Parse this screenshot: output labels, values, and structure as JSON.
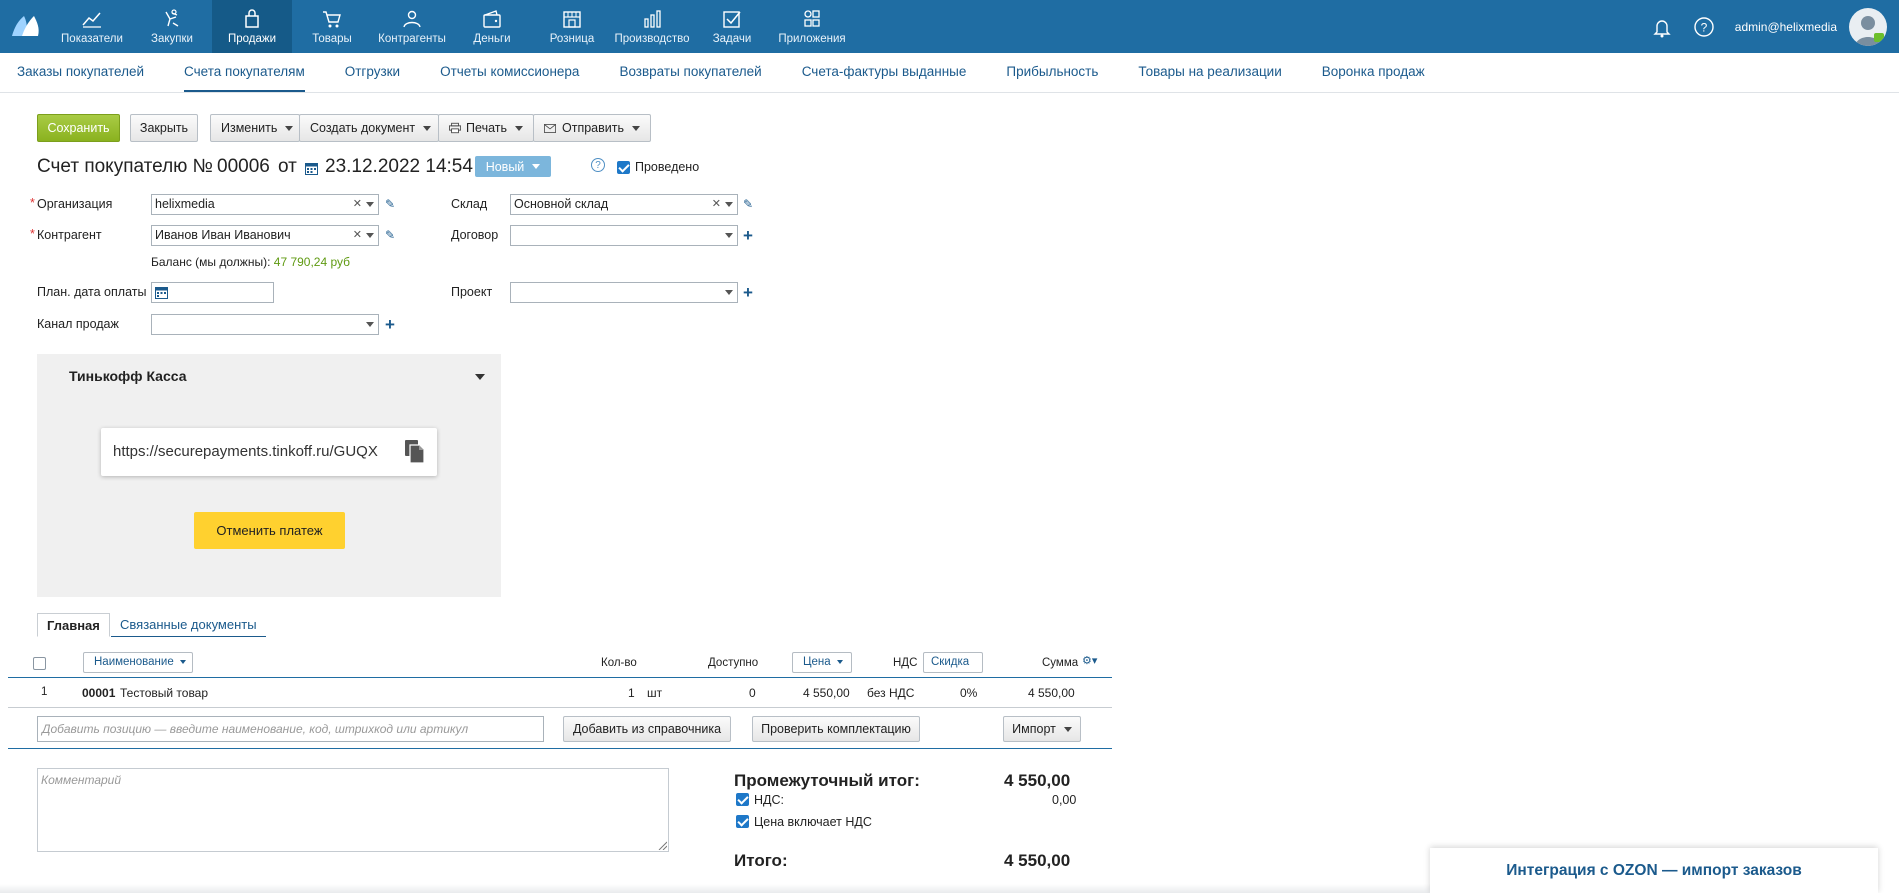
{
  "topbar": {
    "nav": [
      {
        "label": "Показатели",
        "icon": "chart-icon"
      },
      {
        "label": "Закупки",
        "icon": "purchases-icon"
      },
      {
        "label": "Продажи",
        "icon": "sales-bag-icon"
      },
      {
        "label": "Товары",
        "icon": "cart-icon"
      },
      {
        "label": "Контрагенты",
        "icon": "people-icon"
      },
      {
        "label": "Деньги",
        "icon": "wallet-icon"
      },
      {
        "label": "Розница",
        "icon": "store-icon"
      },
      {
        "label": "Производство",
        "icon": "production-icon"
      },
      {
        "label": "Задачи",
        "icon": "tasks-icon"
      },
      {
        "label": "Приложения",
        "icon": "apps-icon"
      }
    ],
    "active_index": 2,
    "user": "admin@helixmedia"
  },
  "subnav": [
    "Заказы покупателей",
    "Счета покупателям",
    "Отгрузки",
    "Отчеты комиссионера",
    "Возвраты покупателей",
    "Счета-фактуры выданные",
    "Прибыльность",
    "Товары на реализации",
    "Воронка продаж"
  ],
  "toolbar": {
    "save": "Сохранить",
    "close": "Закрыть",
    "edit": "Изменить",
    "create_doc": "Создать документ",
    "print": "Печать",
    "send": "Отправить"
  },
  "header": {
    "title": "Счет покупателю №",
    "number": "00006",
    "from": "от",
    "date": "23.12.2022 14:54",
    "state": "Новый",
    "help": "?",
    "posted_label": "Проведено",
    "posted": true
  },
  "form": {
    "org_label": "Организация",
    "org_value": "helixmedia",
    "warehouse_label": "Склад",
    "warehouse_value": "Основной склад",
    "counterparty_label": "Контрагент",
    "counterparty_value": "Иванов Иван Иванович",
    "contract_label": "Договор",
    "contract_value": "",
    "balance_label": "Баланс (мы должны):",
    "balance_value": "47 790,24 руб",
    "pay_date_label": "План. дата оплаты",
    "pay_date_value": "",
    "project_label": "Проект",
    "project_value": "",
    "channel_label": "Канал продаж",
    "channel_value": ""
  },
  "tinkoff": {
    "title": "Тинькофф Касса",
    "link": "https://securepayments.tinkoff.ru/GUQX",
    "cancel": "Отменить платеж"
  },
  "tabs": {
    "main": "Главная",
    "related": "Связанные документы"
  },
  "table": {
    "col_name": "Наименование",
    "col_qty": "Кол-во",
    "col_available": "Доступно",
    "col_price": "Цена",
    "col_vat": "НДС",
    "col_discount": "Скидка",
    "col_sum": "Сумма",
    "rows": [
      {
        "n": "1",
        "code": "00001",
        "name": "Тестовый товар",
        "qty": "1",
        "unit": "шт",
        "available": "0",
        "price": "4 550,00",
        "vat": "без НДС",
        "discount": "0%",
        "sum": "4 550,00"
      }
    ],
    "add_placeholder": "Добавить позицию — введите наименование, код, штрихкод или артикул",
    "add_from_catalog": "Добавить из справочника",
    "check_kit": "Проверить комплектацию",
    "import": "Импорт"
  },
  "footer": {
    "comment_placeholder": "Комментарий",
    "subtotal_label": "Промежуточный итог:",
    "subtotal_value": "4 550,00",
    "vat_label": "НДС:",
    "vat_value": "0,00",
    "vat_checked": true,
    "price_incl_vat_label": "Цена включает НДС",
    "price_incl_vat_checked": true,
    "total_label": "Итого:",
    "total_value": "4 550,00"
  },
  "ozon_banner": "Интеграция с OZON — импорт заказов",
  "colors": {
    "topbar": "#1f6da3",
    "accent_link": "#1b5a8c",
    "save_green": "#8ab21f",
    "state_blue": "#7cb6dc",
    "tinkoff_yellow": "#ffd12f",
    "balance_green": "#5f9a12"
  }
}
